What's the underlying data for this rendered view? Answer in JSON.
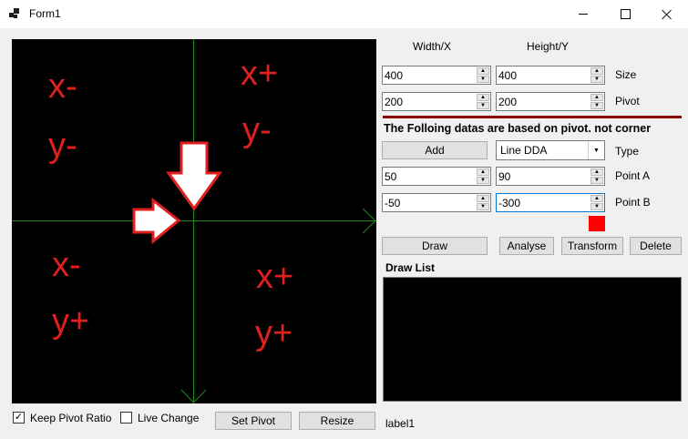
{
  "window": {
    "title": "Form1"
  },
  "canvas": {
    "quadrants": [
      {
        "x": "x-",
        "y": "y-"
      },
      {
        "x": "x+",
        "y": "y-"
      },
      {
        "x": "x-",
        "y": "y+"
      },
      {
        "x": "x+",
        "y": "y+"
      }
    ],
    "axis_color": "#1a8a1a",
    "label_color": "#e01f1f"
  },
  "headers": {
    "width": "Width/X",
    "height": "Height/Y"
  },
  "size": {
    "label": "Size",
    "width": "400",
    "height": "400"
  },
  "pivot": {
    "label": "Pivot",
    "x": "200",
    "y": "200"
  },
  "note": "The Folloing datas are based on pivot. not corner",
  "type": {
    "label": "Type",
    "add_label": "Add",
    "selected": "Line DDA"
  },
  "point_a": {
    "label": "Point A",
    "x": "50",
    "y": "90"
  },
  "point_b": {
    "label": "Point B",
    "x": "-50",
    "y": "-300"
  },
  "color_swatch": "#ff0000",
  "actions": {
    "draw": "Draw",
    "analyse": "Analyse",
    "transform": "Transform",
    "delete": "Delete"
  },
  "draw_list": {
    "label": "Draw List"
  },
  "bottom": {
    "keep_pivot_ratio": "Keep Pivot Ratio",
    "live_change": "Live Change",
    "set_pivot": "Set Pivot",
    "resize": "Resize",
    "status": "label1"
  }
}
